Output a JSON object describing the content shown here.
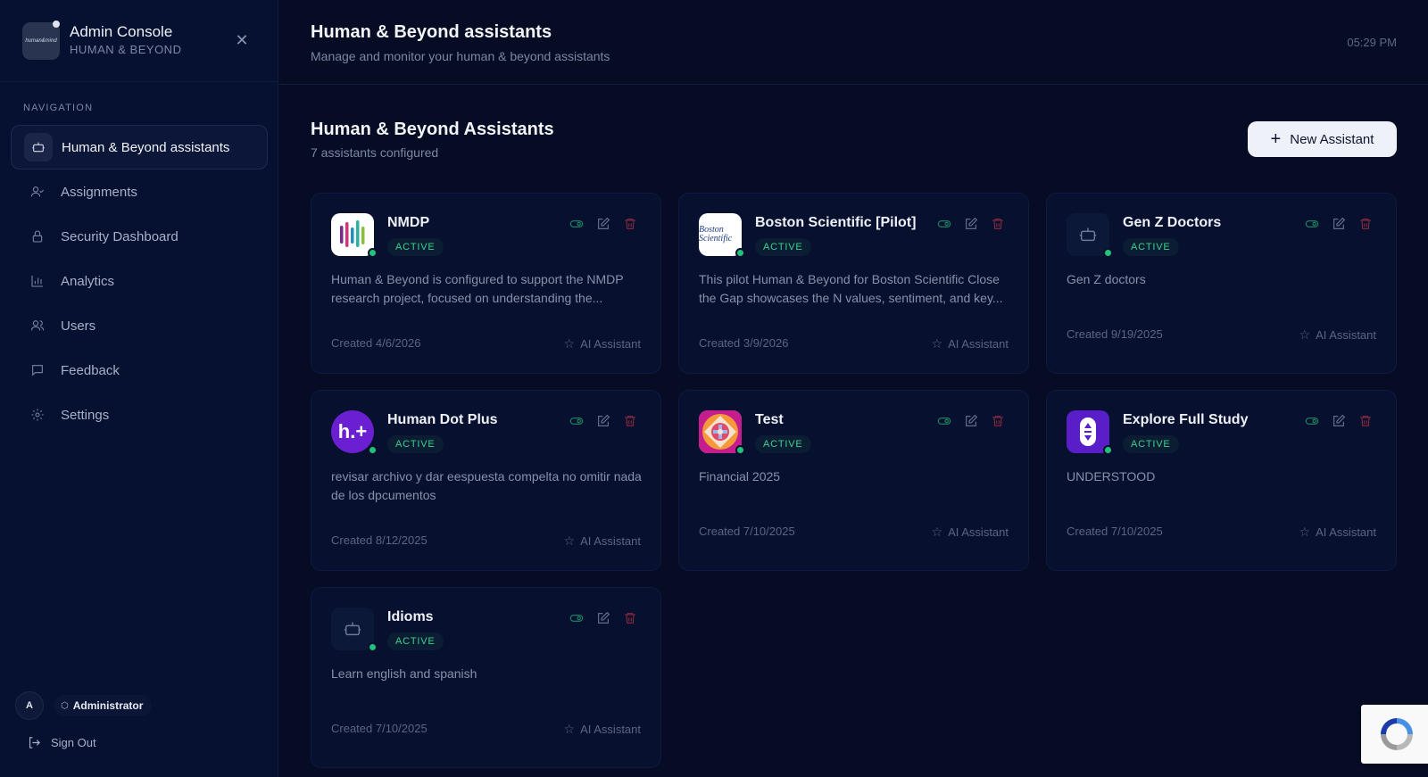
{
  "brand": {
    "title": "Admin Console",
    "subtitle": "HUMAN & BEYOND",
    "logo_text": "human&mind"
  },
  "nav": {
    "section_title": "NAVIGATION",
    "items": [
      {
        "label": "Human & Beyond assistants",
        "icon": "bot-icon",
        "active": true
      },
      {
        "label": "Assignments",
        "icon": "user-check-icon"
      },
      {
        "label": "Security Dashboard",
        "icon": "lock-icon"
      },
      {
        "label": "Analytics",
        "icon": "bar-chart-icon"
      },
      {
        "label": "Users",
        "icon": "users-icon"
      },
      {
        "label": "Feedback",
        "icon": "message-square-icon"
      },
      {
        "label": "Settings",
        "icon": "gear-icon"
      }
    ]
  },
  "user": {
    "avatar_initial": "A",
    "role": "Administrator",
    "signout_label": "Sign Out"
  },
  "header": {
    "title": "Human & Beyond assistants",
    "subtitle": "Manage and monitor your human & beyond assistants",
    "time": "05:29 PM"
  },
  "section": {
    "title": "Human & Beyond Assistants",
    "count_text": "7 assistants configured",
    "new_button_label": "New Assistant"
  },
  "cards": [
    {
      "name": "NMDP",
      "status": "ACTIVE",
      "description": "Human & Beyond is configured to support the NMDP research project, focused on understanding the...",
      "created": "Created 4/6/2026",
      "type": "AI Assistant",
      "avatar": "nmdp-logo"
    },
    {
      "name": "Boston Scientific [Pilot]",
      "status": "ACTIVE",
      "description": "This pilot Human & Beyond for Boston Scientific Close the Gap showcases the N values, sentiment, and key...",
      "created": "Created 3/9/2026",
      "type": "AI Assistant",
      "avatar": "boston-scientific-logo",
      "avatar_text": "Boston Scientific"
    },
    {
      "name": "Gen Z Doctors",
      "status": "ACTIVE",
      "description": "Gen Z doctors",
      "created": "Created 9/19/2025",
      "type": "AI Assistant",
      "avatar": "bot-icon"
    },
    {
      "name": "Human Dot Plus",
      "status": "ACTIVE",
      "description": "revisar archivo y dar eespuesta compelta no omitir nada de los dpcumentos",
      "created": "Created 8/12/2025",
      "type": "AI Assistant",
      "avatar": "human-dot-plus-logo",
      "avatar_text": "h.+"
    },
    {
      "name": "Test",
      "status": "ACTIVE",
      "description": "Financial 2025",
      "created": "Created 7/10/2025",
      "type": "AI Assistant",
      "avatar": "test-pattern-logo"
    },
    {
      "name": "Explore Full Study",
      "status": "ACTIVE",
      "description": "UNDERSTOOD",
      "created": "Created 7/10/2025",
      "type": "AI Assistant",
      "avatar": "explore-logo"
    },
    {
      "name": "Idioms",
      "status": "ACTIVE",
      "description": "Learn english and spanish",
      "created": "Created 7/10/2025",
      "type": "AI Assistant",
      "avatar": "bot-icon"
    }
  ],
  "colors": {
    "background": "#050c24",
    "sidebar": "#061031",
    "card": "#07112f",
    "active_green": "#21c37a",
    "delete_red": "#8b2a3c",
    "toggle_teal": "#1d8c64"
  }
}
